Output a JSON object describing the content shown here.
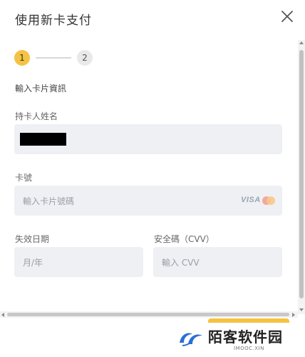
{
  "dialog": {
    "title": "使用新卡支付",
    "close_icon": "close-icon"
  },
  "stepper": {
    "steps": [
      {
        "label": "1",
        "state": "active"
      },
      {
        "label": "2",
        "state": "inactive"
      }
    ],
    "active_color": "#f5c343"
  },
  "form": {
    "section_title": "輸入卡片資訊",
    "cardholder": {
      "label": "持卡人姓名",
      "value": ""
    },
    "card_number": {
      "label": "卡號",
      "placeholder": "輸入卡片號碼",
      "brands": [
        "VISA",
        "mastercard-icon"
      ]
    },
    "expiry": {
      "label": "失效日期",
      "placeholder": "月/年"
    },
    "cvv": {
      "label": "安全碼（CVV）",
      "placeholder": "輸入 CVV"
    }
  },
  "watermark": {
    "text": "陌客软件园",
    "sub": "IMOOC.XIN"
  }
}
